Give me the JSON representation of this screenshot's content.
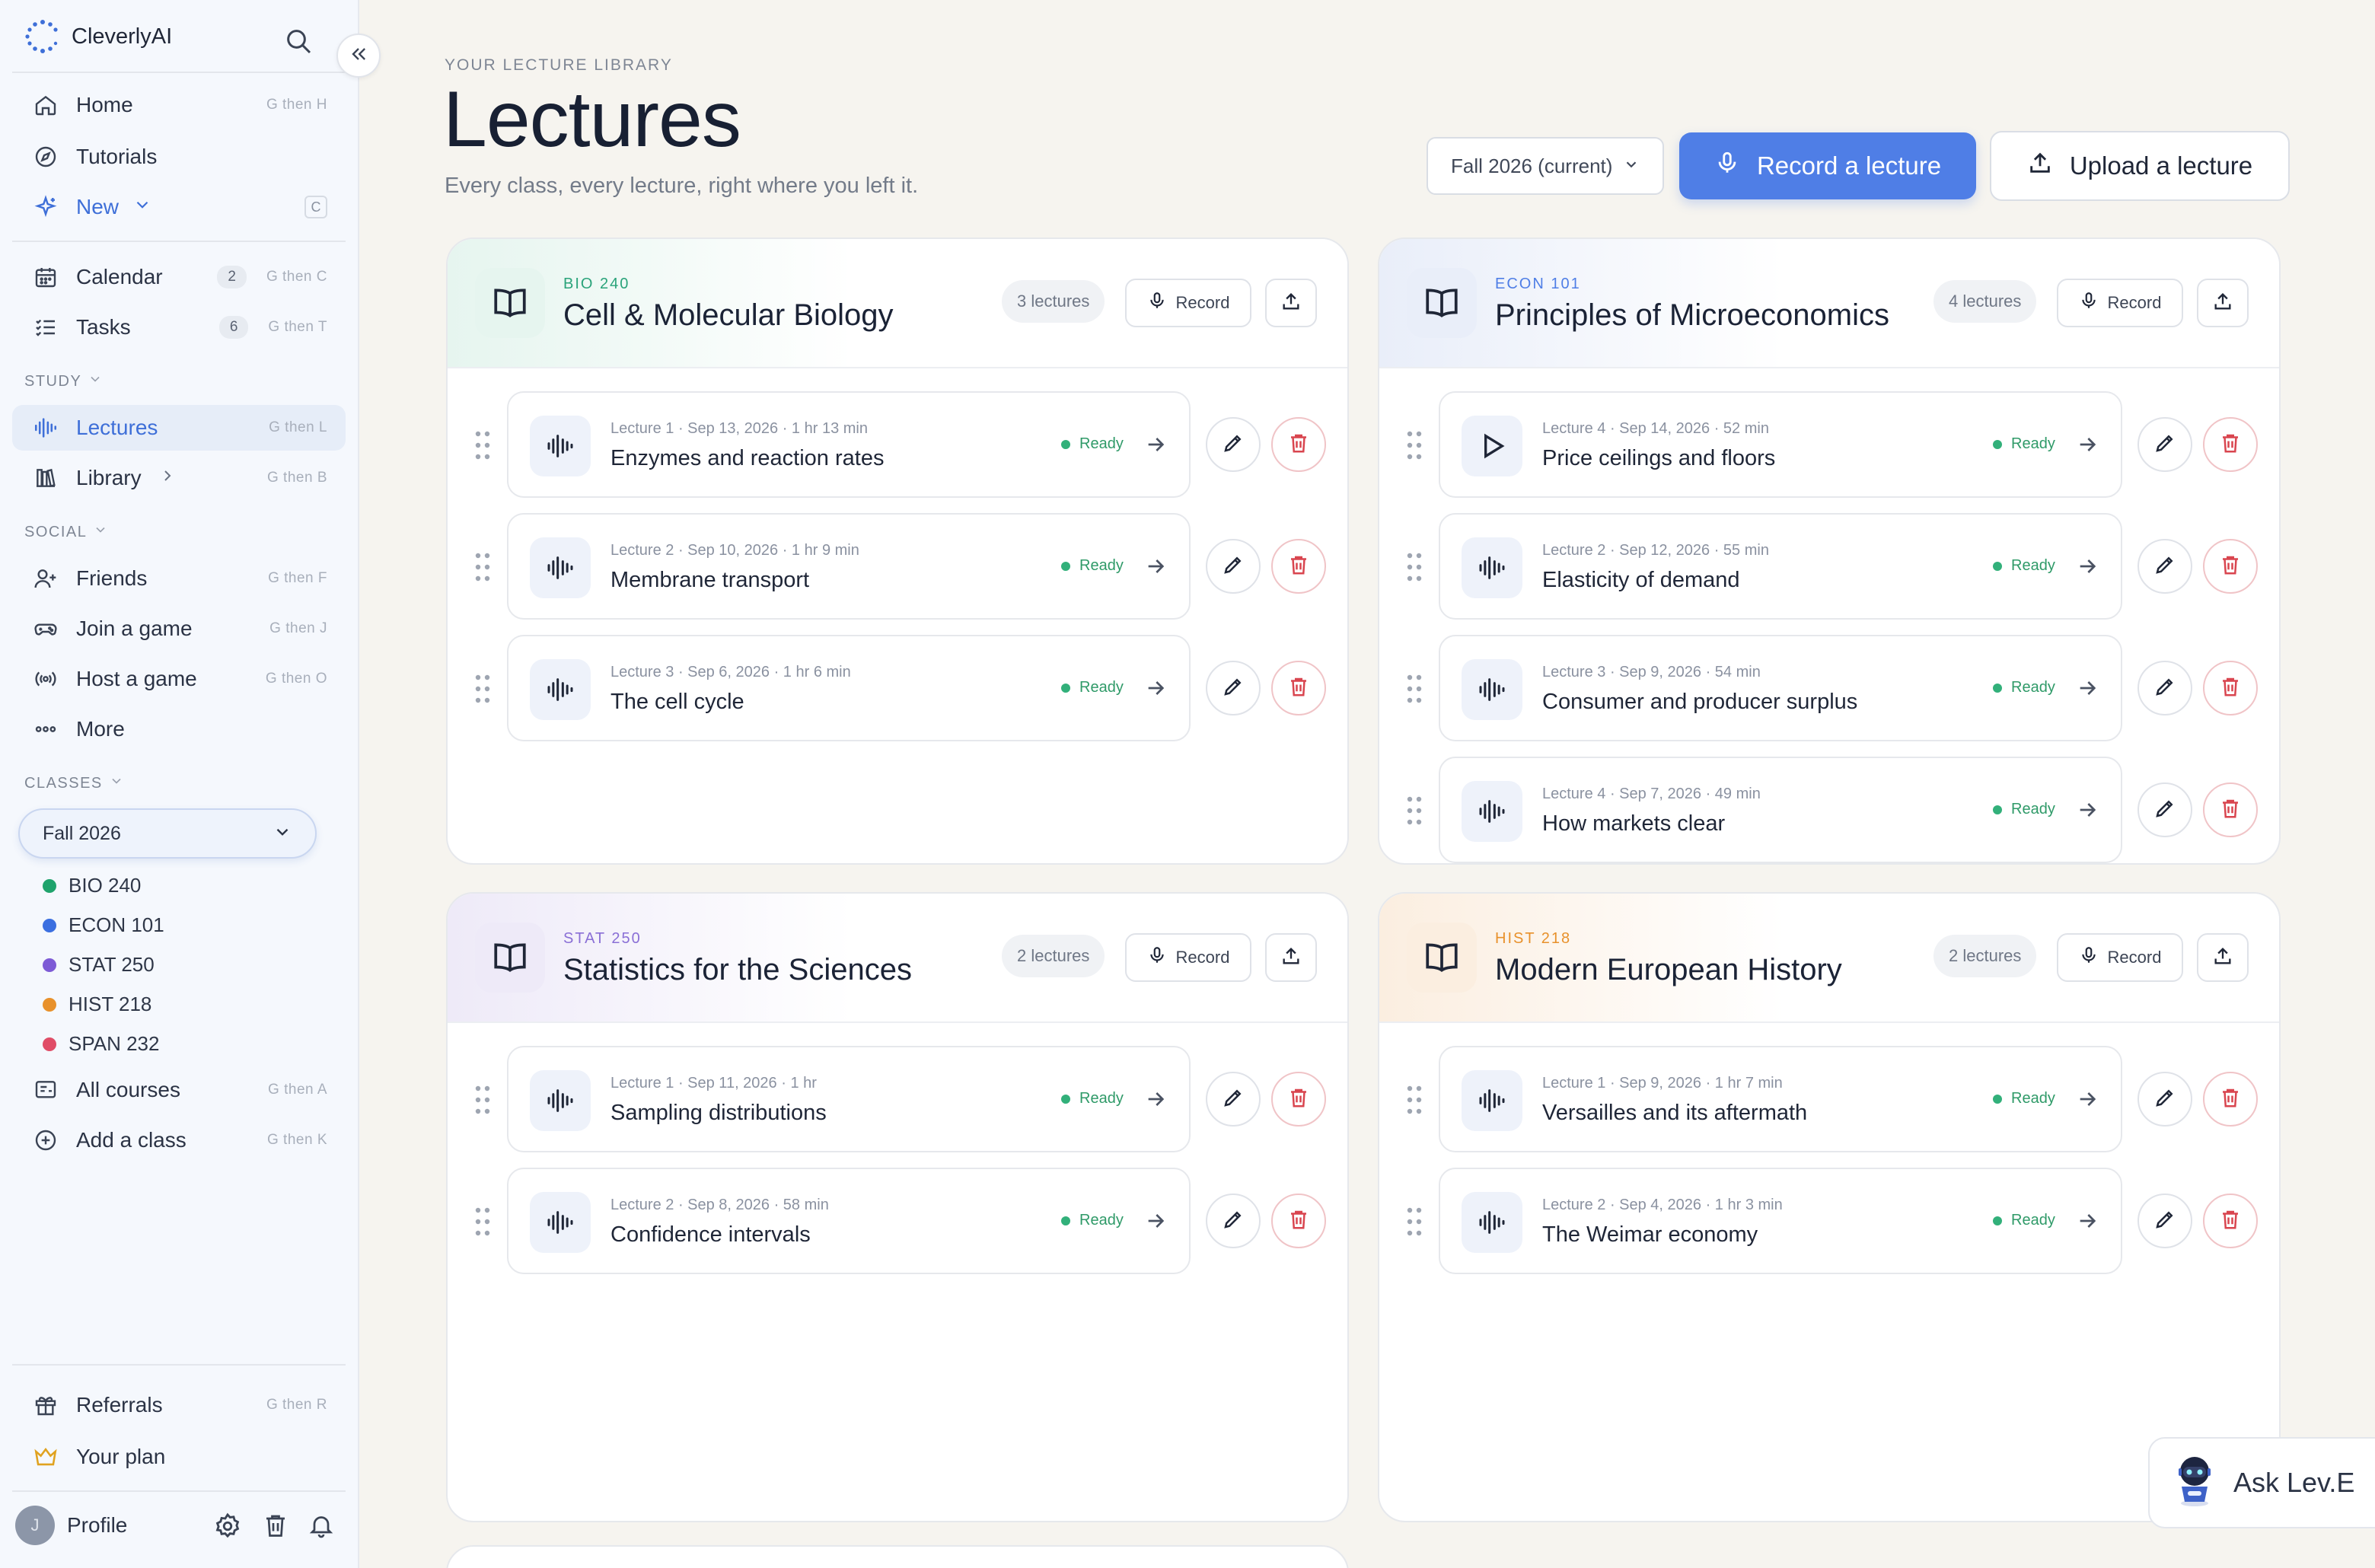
{
  "app": {
    "name": "CleverlyAI"
  },
  "sidebar": {
    "nav": [
      {
        "label": "Home",
        "shortcut": "G then H"
      },
      {
        "label": "Tutorials",
        "shortcut": ""
      },
      {
        "label": "New",
        "shortcut": "C"
      }
    ],
    "calendar": {
      "label": "Calendar",
      "count": "2",
      "shortcut": "G then C"
    },
    "tasks": {
      "label": "Tasks",
      "count": "6",
      "shortcut": "G then T"
    },
    "study_header": "STUDY",
    "study": [
      {
        "label": "Lectures",
        "shortcut": "G then L"
      },
      {
        "label": "Library",
        "shortcut": "G then B"
      }
    ],
    "social_header": "SOCIAL",
    "social": [
      {
        "label": "Friends",
        "shortcut": "G then F"
      },
      {
        "label": "Join a game",
        "shortcut": "G then J"
      },
      {
        "label": "Host a game",
        "shortcut": "G then O"
      },
      {
        "label": "More",
        "shortcut": ""
      }
    ],
    "classes_header": "CLASSES",
    "term_select": "Fall 2026",
    "classes": [
      {
        "label": "BIO 240",
        "color": "#1fa36c"
      },
      {
        "label": "ECON 101",
        "color": "#3b6fe0"
      },
      {
        "label": "STAT 250",
        "color": "#7d5bd6"
      },
      {
        "label": "HIST 218",
        "color": "#e8912b"
      },
      {
        "label": "SPAN 232",
        "color": "#e04d67"
      }
    ],
    "all_courses": {
      "label": "All courses",
      "shortcut": "G then A"
    },
    "add_class": {
      "label": "Add a class",
      "shortcut": "G then K"
    },
    "referrals": {
      "label": "Referrals",
      "shortcut": "G then R"
    },
    "your_plan": "Your plan",
    "profile": {
      "initial": "J",
      "label": "Profile"
    }
  },
  "header": {
    "eyebrow": "YOUR LECTURE LIBRARY",
    "title": "Lectures",
    "subtitle": "Every class, every lecture, right where you left it.",
    "term_select": "Fall 2026 (current)",
    "record_button": "Record a lecture",
    "upload_button": "Upload a lecture"
  },
  "courses": [
    {
      "code": "BIO 240",
      "title": "Cell & Molecular Biology",
      "count": "3 lectures",
      "accent": "#2aa37a",
      "tint": "#e6f5ef",
      "record": "Record",
      "lectures": [
        {
          "meta": "Lecture 1 · Sep 13, 2026 · 1 hr 13 min",
          "title": "Enzymes and reaction rates",
          "status": "Ready",
          "icon": "waveform-icon"
        },
        {
          "meta": "Lecture 2 · Sep 10, 2026 · 1 hr 9 min",
          "title": "Membrane transport",
          "status": "Ready",
          "icon": "waveform-icon"
        },
        {
          "meta": "Lecture 3 · Sep 6, 2026 · 1 hr 6 min",
          "title": "The cell cycle",
          "status": "Ready",
          "icon": "waveform-icon"
        }
      ]
    },
    {
      "code": "ECON 101",
      "title": "Principles of Microeconomics",
      "count": "4 lectures",
      "accent": "#4f7ee6",
      "tint": "#e9eef9",
      "record": "Record",
      "lectures": [
        {
          "meta": "Lecture 4 · Sep 14, 2026 · 52 min",
          "title": "Price ceilings and floors",
          "status": "Ready",
          "icon": "play-icon"
        },
        {
          "meta": "Lecture 2 · Sep 12, 2026 · 55 min",
          "title": "Elasticity of demand",
          "status": "Ready",
          "icon": "waveform-icon"
        },
        {
          "meta": "Lecture 3 · Sep 9, 2026 · 54 min",
          "title": "Consumer and producer surplus",
          "status": "Ready",
          "icon": "waveform-icon"
        },
        {
          "meta": "Lecture 4 · Sep 7, 2026 · 49 min",
          "title": "How markets clear",
          "status": "Ready",
          "icon": "waveform-icon"
        }
      ]
    },
    {
      "code": "STAT 250",
      "title": "Statistics for the Sciences",
      "count": "2 lectures",
      "accent": "#8a6fd6",
      "tint": "#eeeaf8",
      "record": "Record",
      "lectures": [
        {
          "meta": "Lecture 1 · Sep 11, 2026 · 1 hr",
          "title": "Sampling distributions",
          "status": "Ready",
          "icon": "waveform-icon"
        },
        {
          "meta": "Lecture 2 · Sep 8, 2026 · 58 min",
          "title": "Confidence intervals",
          "status": "Ready",
          "icon": "waveform-icon"
        }
      ]
    },
    {
      "code": "HIST 218",
      "title": "Modern European History",
      "count": "2 lectures",
      "accent": "#e8912b",
      "tint": "#fbeee0",
      "record": "Record",
      "lectures": [
        {
          "meta": "Lecture 1 · Sep 9, 2026 · 1 hr 7 min",
          "title": "Versailles and its aftermath",
          "status": "Ready",
          "icon": "waveform-icon"
        },
        {
          "meta": "Lecture 2 · Sep 4, 2026 · 1 hr 3 min",
          "title": "The Weimar economy",
          "status": "Ready",
          "icon": "waveform-icon"
        }
      ]
    }
  ],
  "assistant": {
    "label": "Ask Lev.E"
  }
}
